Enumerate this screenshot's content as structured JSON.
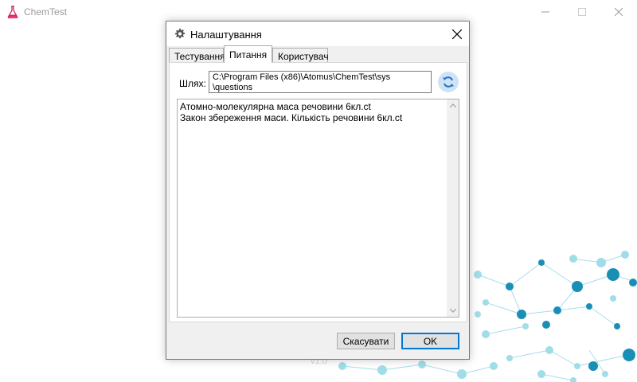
{
  "app": {
    "title": "ChemTest",
    "version": "v1.0"
  },
  "dialog": {
    "title": "Налаштування",
    "tabs": [
      {
        "label": "Тестування",
        "active": false
      },
      {
        "label": "Питання",
        "active": true
      },
      {
        "label": "Користувач",
        "active": false
      }
    ],
    "path_label": "Шлях:",
    "path_value": "C:\\Program Files (x86)\\Atomus\\ChemTest\\sys\n\\questions",
    "files": [
      "Атомно-молекулярна маса речовини 6кл.ct",
      "Закон збереження маси. Кількість речовини 6кл.ct"
    ],
    "buttons": {
      "cancel": "Скасувати",
      "ok": "OK"
    }
  },
  "colors": {
    "accent": "#0078d7",
    "refresh_bg": "#cfe3f5",
    "molecule_dark": "#1a8fb5",
    "molecule_light": "#9fdde8"
  },
  "icons": {
    "app": "flask-icon",
    "dialog": "gear-icon",
    "refresh": "refresh-icon"
  }
}
